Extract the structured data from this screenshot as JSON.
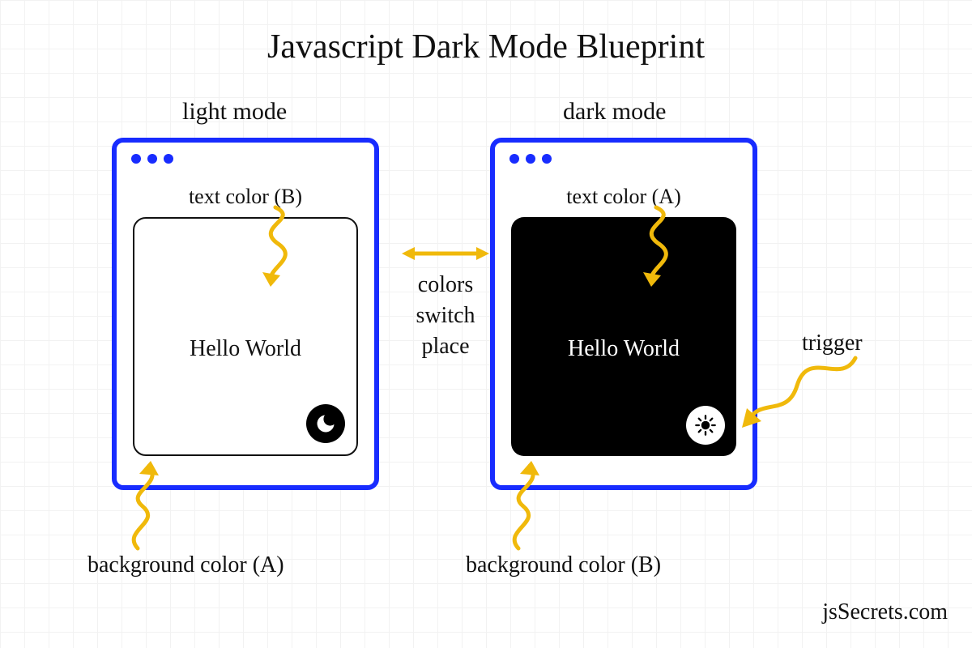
{
  "title": "Javascript Dark Mode Blueprint",
  "credit": "jsSecrets.com",
  "switch_text": "colors\nswitch\nplace",
  "light": {
    "label": "light mode",
    "text_color_label": "text color (B)",
    "bg_color_label": "background color (A)",
    "content": "Hello World",
    "toggle_icon": "moon-icon"
  },
  "dark": {
    "label": "dark mode",
    "text_color_label": "text color (A)",
    "bg_color_label": "background color (B)",
    "content": "Hello World",
    "toggle_icon": "sun-icon",
    "trigger_label": "trigger"
  },
  "colors": {
    "window_border": "#182cff",
    "arrow": "#f0b90b",
    "light_bg": "#ffffff",
    "light_text": "#000000",
    "dark_bg": "#000000",
    "dark_text": "#ffffff"
  }
}
